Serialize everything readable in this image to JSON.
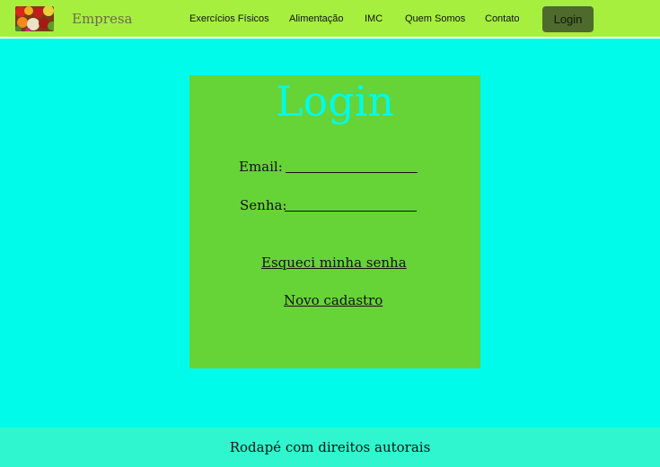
{
  "navbar": {
    "logo_icon": "fruits-logo-icon",
    "brand": "Empresa",
    "links": [
      "Exercícios Físicos",
      "Alimentação",
      "IMC",
      "Quem Somos",
      "Contato"
    ],
    "login_button": "Login"
  },
  "login": {
    "title": "Login",
    "email_label": "Email:",
    "email_value": "",
    "password_label": "Senha:",
    "password_value": "",
    "forgot_link": "Esqueci minha senha",
    "register_link": "Novo cadastro"
  },
  "footer": {
    "text": "Rodapé com direitos autorais"
  },
  "colors": {
    "page_bg": "#00fbea",
    "navbar_bg": "#a6ef3f",
    "card_bg": "#66d337",
    "login_button_bg": "#4e6a2c",
    "footer_bg": "#30f6cf"
  }
}
